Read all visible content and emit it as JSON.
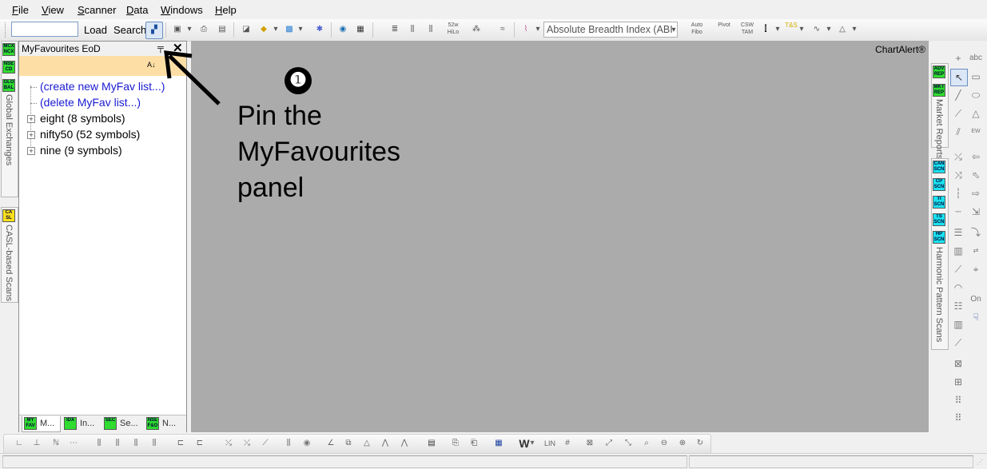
{
  "menu": [
    "File",
    "View",
    "Scanner",
    "Data",
    "Windows",
    "Help"
  ],
  "toolbar": {
    "symbol_value": "",
    "load_label": "Load",
    "search_label": "Search",
    "study_select": "Absolute Breadth Index (ABI",
    "icons": [
      "52w HiLo",
      "Auto Fibo",
      "Pivot",
      "CSW TAM",
      "T&S"
    ]
  },
  "left_tabs": [
    {
      "badge": "MCX NCX",
      "color": "#2fdc2f"
    },
    {
      "badge": "NSE CD",
      "color": "#2fdc2f"
    },
    {
      "badge": "GLO BAL",
      "color": "#2fdc2f",
      "label": "Global Exchanges"
    },
    {
      "badge": "CA SL",
      "color": "#ffe11a",
      "label": "CASL-based Scans"
    }
  ],
  "fav_panel": {
    "title": "MyFavourites EoD",
    "items": [
      {
        "label": "(create new MyFav list...)",
        "type": "link"
      },
      {
        "label": "(delete MyFav list...)",
        "type": "link"
      },
      {
        "label": "eight (8 symbols)",
        "type": "group"
      },
      {
        "label": "nifty50 (52 symbols)",
        "type": "group"
      },
      {
        "label": "nine (9 symbols)",
        "type": "group"
      }
    ],
    "bottom_tabs": [
      {
        "badge": "MY FAV",
        "label": "M..."
      },
      {
        "badge": "IDX",
        "label": "In..."
      },
      {
        "badge": "SEC",
        "label": "Se..."
      },
      {
        "badge": "NSE F&O",
        "label": "N..."
      }
    ]
  },
  "chart": {
    "brand": "ChartAlert®"
  },
  "right_tabs": [
    {
      "badge": "ADV REP",
      "color": "#2fdc2f"
    },
    {
      "badge": "MKT REP",
      "color": "#2fdc2f",
      "label": "Market Reports"
    },
    {
      "badge": "CAN SCN",
      "color": "#19e3f0"
    },
    {
      "badge": "CP SCN",
      "color": "#19e3f0"
    },
    {
      "badge": "TI SCN",
      "color": "#19e3f0"
    },
    {
      "badge": "TS SCN",
      "color": "#19e3f0"
    },
    {
      "badge": "HP SCN",
      "color": "#19e3f0",
      "label": "Harmonic Pattern Scans"
    }
  ],
  "draw_toolbar": [
    "abc",
    "On"
  ],
  "bottom_toolbar": [
    "W",
    "LIN"
  ],
  "annotation": {
    "number": "❶",
    "text_lines": [
      "Pin the",
      "MyFavourites",
      "panel"
    ]
  }
}
